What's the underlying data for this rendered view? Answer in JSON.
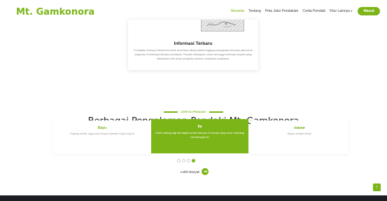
{
  "nav": {
    "brand": "Mt. Gamkonora",
    "items": [
      {
        "label": "Beranda",
        "active": true
      },
      {
        "label": "Tentang",
        "active": false
      },
      {
        "label": "Peta Jalur Pendakian",
        "active": false
      },
      {
        "label": "Cerita Pendaki",
        "active": false
      },
      {
        "label": "Fitur Lainnya",
        "active": false
      }
    ],
    "dropdown_caret": "▾",
    "login_label": "Masuk"
  },
  "info": {
    "image_icon": "trail-map-image",
    "title": "Informasi Terbaru",
    "body": "Pendakian Gunung Gamkonora untuk sementara ditutup akibat tingginya peningkatan bencana alam serta longsoran di beberapa titik jalur pendakian. Pendaki diharapkan untuk menunggu informasi lanjutan yang dikeluarkan oleh pihak pengelola sebelum melakukan perjalanan."
  },
  "testimonials": {
    "kicker": "CERITA PENDAKI",
    "title": "Berbagai Pengalaman Pendaki Mt. Gamkonora",
    "cards": [
      {
        "name": "Bayu",
        "text": "Sayang sekali, ngga ada tempat nyaman di gunung ini"
      },
      {
        "name": "Ita",
        "text": "Kamu datang lagi kita dapat sunset dan pos 3 menuju camp area. memang mal sebagus itu"
      },
      {
        "name": "mawar",
        "text": "Bagus banget sekali"
      }
    ],
    "pagination": {
      "count": 4,
      "active_index": 3
    },
    "more_label": "Lebih Banyak"
  },
  "back_to_top": "↑",
  "colors": {
    "accent": "#7cb518",
    "footer": "#1b1d22"
  }
}
